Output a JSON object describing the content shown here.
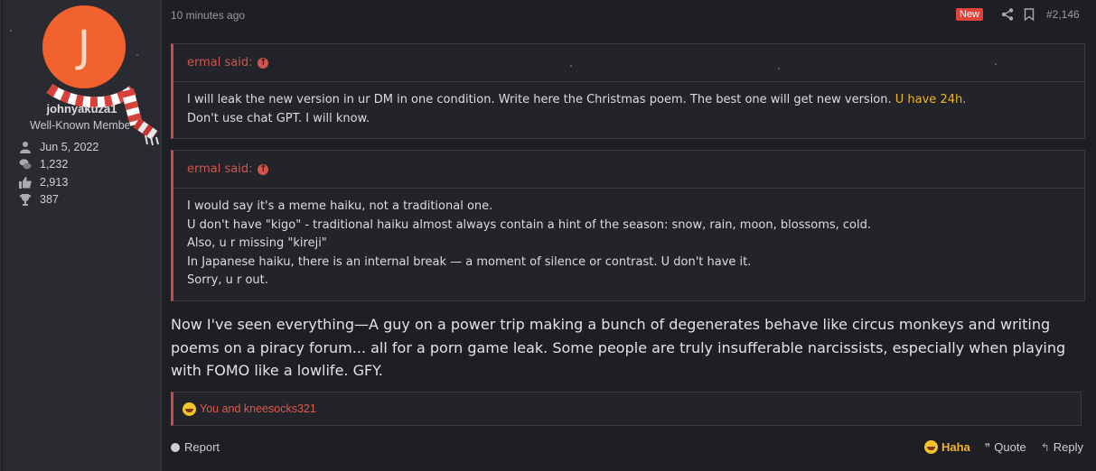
{
  "user": {
    "avatar_letter": "J",
    "avatar_color": "#f2622e",
    "username": "johnyakuza1",
    "title": "Well-Known Member",
    "joined": "Jun 5, 2022",
    "messages": "1,232",
    "reactions": "2,913",
    "points": "387"
  },
  "post": {
    "time": "10 minutes ago",
    "new_badge": "New",
    "number": "#2,146",
    "quotes": [
      {
        "author": "ermal said:",
        "lines": [
          "I will leak the new version in ur DM in one condition. Write here the Christmas poem. The best one will get new version. ",
          "U have 24h.",
          "Don't use chat GPT. I will know."
        ]
      },
      {
        "author": "ermal said:",
        "lines": [
          "I would say it's a meme haiku, not a traditional one.",
          "U don't have \"kigo\" - traditional haiku almost always contain a hint of the season: snow, rain, moon, blossoms, cold.",
          "Also, u r missing \"kireji\"",
          "In Japanese haiku, there is an internal break — a moment of silence or contrast. U don't have it.",
          "Sorry, u r out."
        ]
      }
    ],
    "message": "Now I've seen everything—A guy on a power trip making a bunch of degenerates behave like circus monkeys and writing poems on a piracy forum... all for a porn game leak. Some people are truly insufferable narcissists, especially when playing with FOMO like a lowlife. GFY.",
    "reactions_text": "You and kneesocks321"
  },
  "footer": {
    "report": "Report",
    "haha": "Haha",
    "quote": "Quote",
    "reply": "Reply"
  },
  "colors": {
    "accent": "#c94d4d",
    "highlight": "#f0b429",
    "badge": "#e0433c"
  }
}
